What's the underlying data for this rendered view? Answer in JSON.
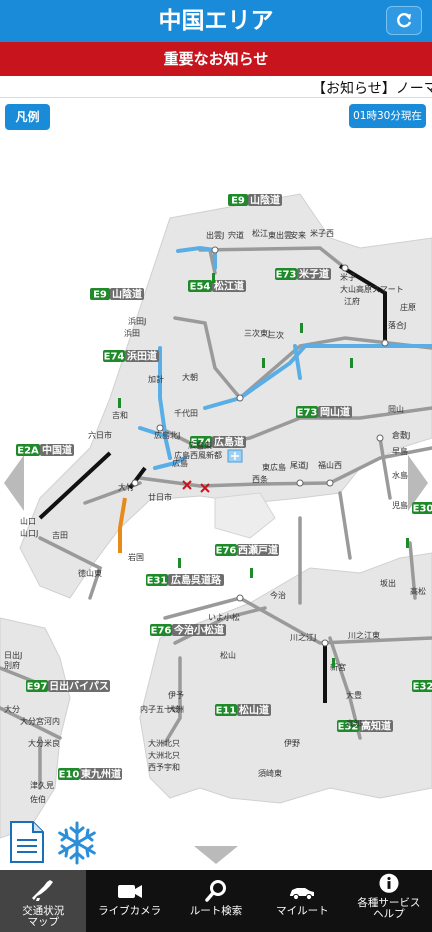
{
  "header": {
    "title": "中国エリア",
    "refresh_icon": "refresh-icon"
  },
  "notice": {
    "label": "重要なお知らせ"
  },
  "ticker": {
    "text": "【お知らせ】ノーマル"
  },
  "map": {
    "legend_button": "凡例",
    "time_badge": "01時30分現在",
    "route_badges": [
      {
        "code": "E9",
        "name": "山陰道"
      },
      {
        "code": "E54",
        "name": "松江道"
      },
      {
        "code": "E73",
        "name": "米子道"
      },
      {
        "code": "E9",
        "name": "山陰道"
      },
      {
        "code": "E74",
        "name": "浜田道"
      },
      {
        "code": "E73",
        "name": "岡山道"
      },
      {
        "code": "E74",
        "name": "広島道"
      },
      {
        "code": "E2A",
        "name": "中国道"
      },
      {
        "code": "E76",
        "name": "西瀬戸道"
      },
      {
        "code": "E31",
        "name": "広島呉道路"
      },
      {
        "code": "E76",
        "name": "今治小松道"
      },
      {
        "code": "E97",
        "name": "日出バイパス"
      },
      {
        "code": "E11",
        "name": "松山道"
      },
      {
        "code": "E32",
        "name": "高知道"
      },
      {
        "code": "E10",
        "name": "東九州道"
      },
      {
        "code": "E30",
        "name": ""
      },
      {
        "code": "E32",
        "name": ""
      }
    ],
    "place_names": [
      "出雲J",
      "宍道",
      "松江",
      "東出雲",
      "安来",
      "米子西",
      "米子",
      "大山高原スマート",
      "江府",
      "落合J",
      "庄原",
      "三次",
      "三次東J",
      "東広島",
      "西条",
      "広島",
      "広島東",
      "広島北J",
      "千代田",
      "大朝",
      "浜田",
      "浜田J",
      "加計",
      "吉和",
      "六日市",
      "山口",
      "山口J",
      "徳山東",
      "岩国",
      "大竹",
      "廿日市",
      "広島西風新都",
      "福山西",
      "尾道J",
      "岡山",
      "倉敷J",
      "早島",
      "水島",
      "児島",
      "坂出",
      "高松",
      "今治",
      "いよ小松",
      "川之江J",
      "川之江東",
      "大豊",
      "新宮",
      "高知",
      "伊野",
      "須崎東",
      "大洲北只",
      "大洲",
      "西予宇和",
      "松山",
      "内子五十崎",
      "伊予",
      "大分",
      "別府",
      "日出J",
      "大分宮河内",
      "大分米良",
      "津久見",
      "佐伯",
      "吉田",
      "大洲北只"
    ]
  },
  "icons": {
    "document": "document-icon",
    "snow": "snowflake-icon"
  },
  "tabs": [
    {
      "label": "交通状況\nマップ",
      "icon": "japan-map-icon",
      "active": true
    },
    {
      "label": "ライブカメラ",
      "icon": "video-camera-icon",
      "active": false
    },
    {
      "label": "ルート検索",
      "icon": "search-icon",
      "active": false
    },
    {
      "label": "マイルート",
      "icon": "car-icon",
      "active": false
    },
    {
      "label": "各種サービス\nヘルプ",
      "icon": "info-icon",
      "active": false
    }
  ],
  "colors": {
    "header_blue": "#1a8bd8",
    "notice_red": "#c8141c",
    "badge_green": "#1f8a2a",
    "badge_gray": "#6e6e6e",
    "route_blue": "#5aaee6",
    "route_orange": "#e88a1a",
    "land_gray": "#e5e5e5",
    "tabbar_black": "#111111"
  }
}
